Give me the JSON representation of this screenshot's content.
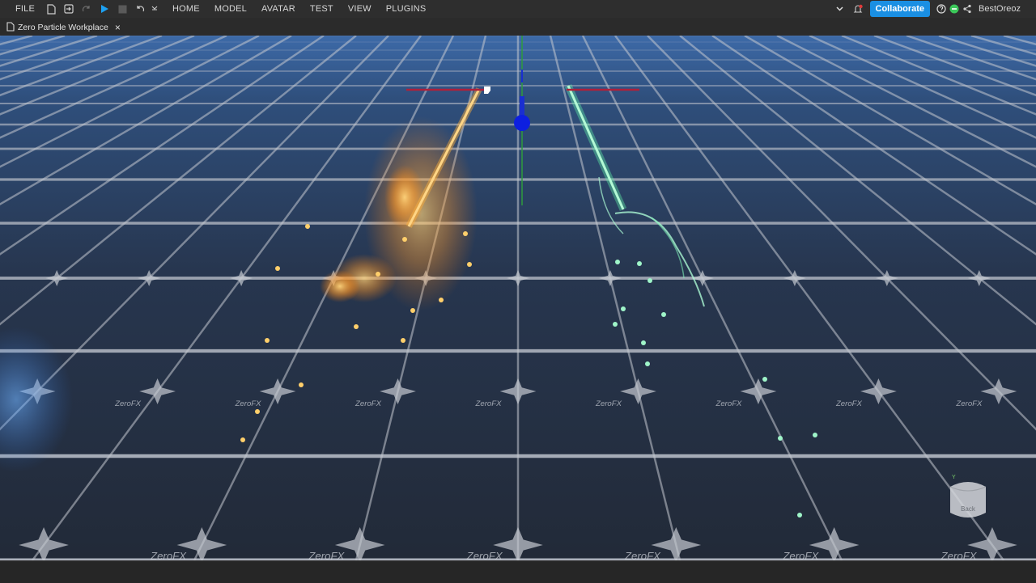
{
  "menu": {
    "file": "FILE",
    "items": [
      "HOME",
      "MODEL",
      "AVATAR",
      "TEST",
      "VIEW",
      "PLUGINS"
    ]
  },
  "toolbar": {
    "collaborate": "Collaborate",
    "username": "BestOreoz",
    "icons": [
      "new-file-icon",
      "open-file-icon",
      "redo-icon",
      "play-icon",
      "stop-icon",
      "undo-icon",
      "more-icon"
    ]
  },
  "tab": {
    "label": "Zero Particle Workplace",
    "close": "×"
  },
  "viewport": {
    "floor_text": "ZeroFX",
    "view_cube_label": "Back",
    "colors": {
      "floor": "#2b3a52",
      "grid": "#c9ccd2",
      "fire": "#ffb13b",
      "energy": "#5ff0a8",
      "sky": "#2f5f9e"
    }
  }
}
